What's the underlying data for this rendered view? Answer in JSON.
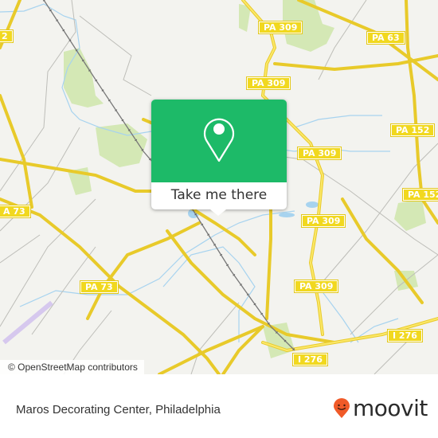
{
  "map": {
    "background_color": "#f3f3ef",
    "road_color": "#f1d81f",
    "water_color": "#a7d3ef",
    "park_color": "#d4e8b5",
    "road_labels": [
      {
        "id": "pa63-top-left",
        "text": "2"
      },
      {
        "id": "pa309-n",
        "text": "PA 309"
      },
      {
        "id": "pa63",
        "text": "PA 63"
      },
      {
        "id": "pa309-mid",
        "text": "PA 309"
      },
      {
        "id": "pa152-n",
        "text": "PA 152"
      },
      {
        "id": "pa309-c",
        "text": "PA 309"
      },
      {
        "id": "pa152-s",
        "text": "PA 152"
      },
      {
        "id": "pa309-ramp",
        "text": "PA 309"
      },
      {
        "id": "pa73-w",
        "text": "A 73"
      },
      {
        "id": "pa309-s",
        "text": "PA 309"
      },
      {
        "id": "pa73",
        "text": "PA 73"
      },
      {
        "id": "i276-e",
        "text": "I 276"
      },
      {
        "id": "i276-w",
        "text": "I 276"
      }
    ]
  },
  "popup": {
    "button_label": "Take me there",
    "accent_color": "#1dba68",
    "icon": "location-pin-icon"
  },
  "attribution": "© OpenStreetMap contributors",
  "footer": {
    "place_name": "Maros Decorating Center, Philadelphia",
    "logo_text": "moovit",
    "logo_color": "#f05a28"
  }
}
